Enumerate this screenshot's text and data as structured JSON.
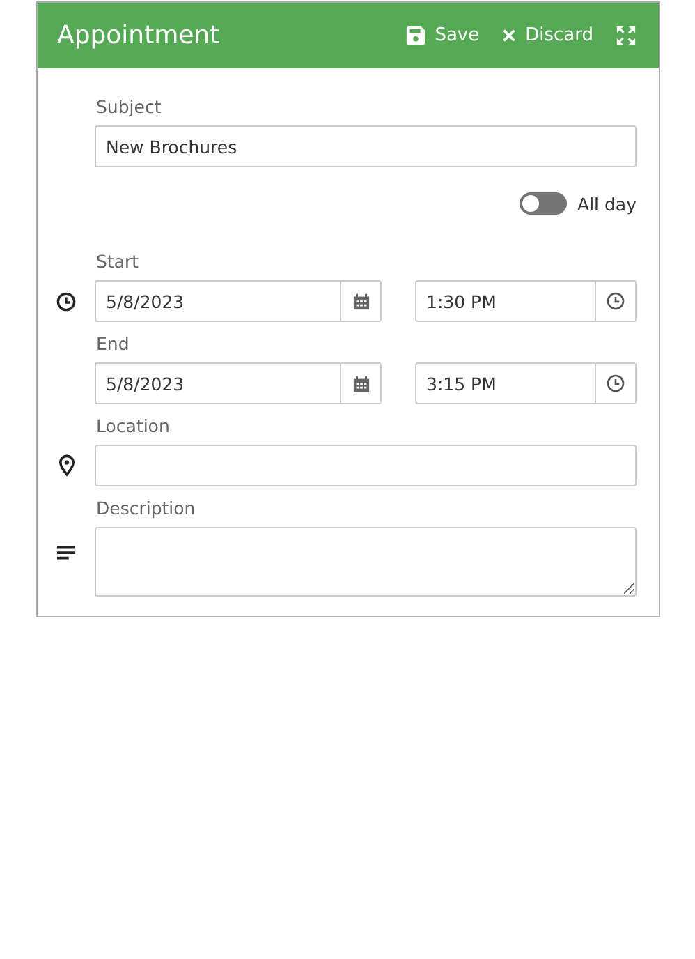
{
  "window": {
    "title": "Appointment"
  },
  "actions": [
    {
      "kind": "save",
      "label": "Save"
    },
    {
      "kind": "discard",
      "label": "Discard"
    },
    {
      "kind": "maximize"
    }
  ],
  "subject": {
    "label": "Subject",
    "value": "New Brochures"
  },
  "all_day": {
    "label": "All day",
    "on": false
  },
  "start": {
    "label": "Start",
    "date": "5/8/2023",
    "time": "1:30 PM"
  },
  "end": {
    "label": "End",
    "date": "5/8/2023",
    "time": "3:15 PM"
  },
  "location": {
    "label": "Location"
  },
  "description": {
    "label": "Description"
  }
}
